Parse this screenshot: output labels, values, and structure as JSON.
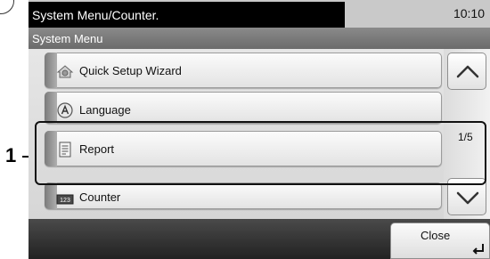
{
  "status": {
    "title": "System Menu/Counter.",
    "time": "10:10"
  },
  "subtitle": "System Menu",
  "menu": {
    "items": [
      {
        "label": "Quick Setup Wizard",
        "icon": "wizard-icon"
      },
      {
        "label": "Language",
        "icon": "language-icon"
      },
      {
        "label": "Report",
        "icon": "report-icon"
      },
      {
        "label": "Counter",
        "icon": "counter-icon"
      }
    ]
  },
  "scroll": {
    "page": "1/5",
    "up_icon": "chevron-up-icon",
    "down_icon": "chevron-down-icon"
  },
  "footer": {
    "close_label": "Close",
    "close_icon": "enter-icon"
  },
  "callout": {
    "number": "1"
  },
  "colors": {
    "status_bar": "#000000",
    "subtitle_bar": "#7a7a7a",
    "panel_bg": "#cfcfcf",
    "bottom_bar": "#333333",
    "highlight": "#111111"
  }
}
